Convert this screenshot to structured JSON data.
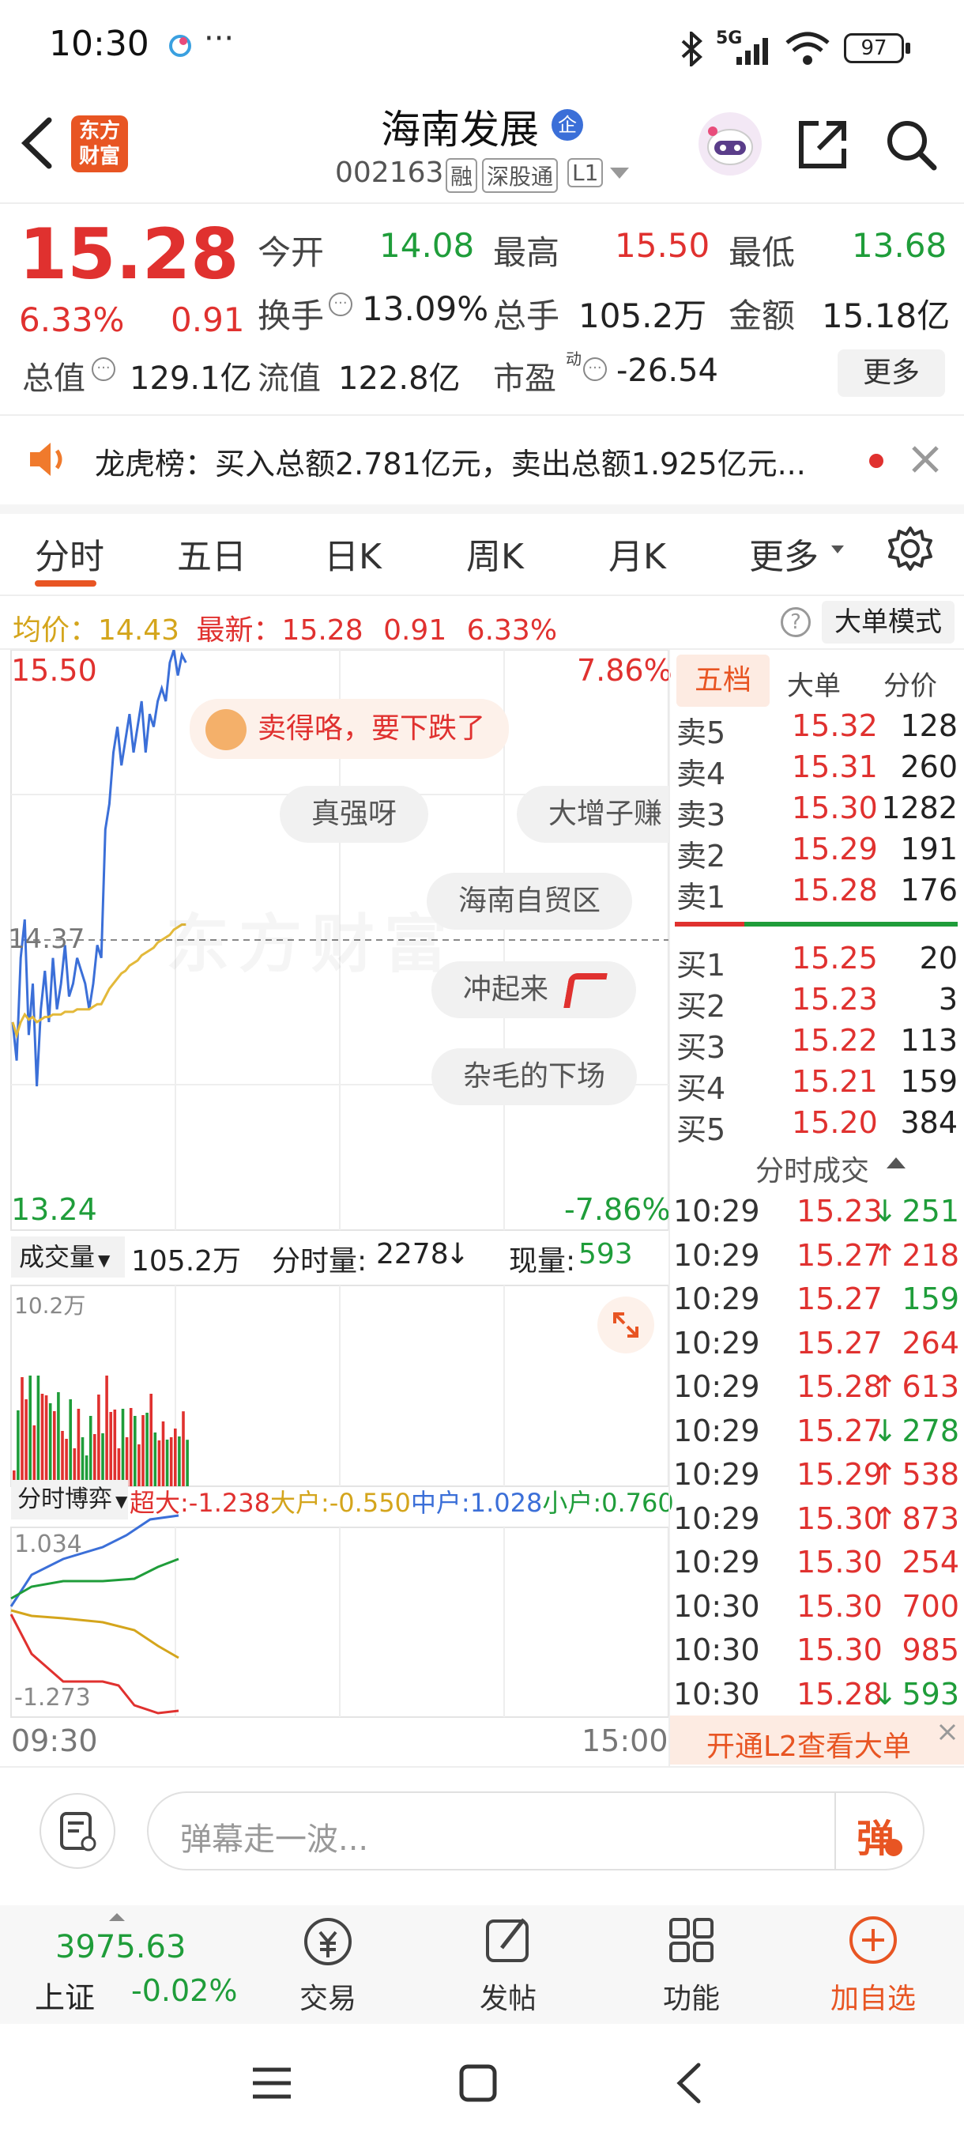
{
  "status": {
    "time": "10:30",
    "more": "···",
    "net": "5G",
    "battery": "97"
  },
  "header": {
    "title": "海南发展",
    "badge": "企",
    "code": "002163",
    "tag1": "融",
    "tag2": "深股通",
    "tag3": "L1",
    "logo_line1": "东方",
    "logo_line2": "财富"
  },
  "quote": {
    "price": "15.28",
    "change_pct": "6.33%",
    "change": "0.91",
    "open_label": "今开",
    "open": "14.08",
    "high_label": "最高",
    "high": "15.50",
    "low_label": "最低",
    "low": "13.68",
    "turnover_label": "换手",
    "turnover": "13.09%",
    "volume_label": "总手",
    "volume": "105.2万",
    "amount_label": "金额",
    "amount": "15.18亿",
    "mktcap_label": "总值",
    "mktcap": "129.1亿",
    "float_label": "流值",
    "float": "122.8亿",
    "pe_label": "市盈",
    "pe_sup": "动",
    "pe": "-26.54",
    "more": "更多"
  },
  "notice": {
    "text": "龙虎榜：买入总额2.781亿元，卖出总额1.925亿元..."
  },
  "tabs": [
    "分时",
    "五日",
    "日K",
    "周K",
    "月K",
    "更多"
  ],
  "info_bar": {
    "avg_label": "均价：",
    "avg": "14.43",
    "latest_label": "最新：",
    "latest": "15.28",
    "change": "0.91",
    "pct": "6.33%",
    "mode": "大单模式"
  },
  "chart": {
    "high": "15.50",
    "low": "13.24",
    "high_pct": "7.86%",
    "low_pct": "-7.86%",
    "mid": "14.37",
    "watermark": "东方财富",
    "vol_label": "成交量",
    "vol_total": "105.2万",
    "vol_fen_label": "分时量:",
    "vol_fen": "2278",
    "vol_now_label": "现量:",
    "vol_now": "593",
    "vol_max": "10.2万",
    "flow_label": "分时博弈",
    "super_label": "超大:",
    "super": "-1.238",
    "big_label": "大户:",
    "big": "-0.550",
    "mid_label": "中户:",
    "mid_val": "1.028",
    "small_label": "小户:",
    "small": "0.760",
    "flow_max": "1.034",
    "flow_min": "-1.273",
    "time_start": "09:30",
    "time_end": "15:00"
  },
  "chart_data": {
    "type": "line",
    "series": [
      {
        "name": "price",
        "values": [
          14.05,
          13.9,
          14.3,
          14.45,
          14.0,
          14.2,
          13.8,
          14.1,
          14.25,
          14.05,
          14.3,
          14.1,
          14.2,
          14.35,
          14.15,
          14.2,
          14.3,
          14.25,
          14.2,
          14.1,
          14.2,
          14.35,
          14.3,
          14.8,
          14.9,
          15.1,
          15.2,
          15.05,
          15.15,
          15.25,
          15.1,
          15.2,
          15.3,
          15.1,
          15.25,
          15.2,
          15.3,
          15.35,
          15.3,
          15.45,
          15.5,
          15.4,
          15.48,
          15.45
        ]
      },
      {
        "name": "均价",
        "values": [
          14.05,
          14.0,
          14.05,
          14.08,
          14.06,
          14.07,
          14.05,
          14.06,
          14.07,
          14.07,
          14.08,
          14.08,
          14.08,
          14.09,
          14.09,
          14.09,
          14.1,
          14.1,
          14.1,
          14.1,
          14.11,
          14.12,
          14.12,
          14.15,
          14.18,
          14.2,
          14.22,
          14.24,
          14.25,
          14.27,
          14.28,
          14.29,
          14.31,
          14.32,
          14.33,
          14.34,
          14.36,
          14.37,
          14.38,
          14.39,
          14.41,
          14.42,
          14.43,
          14.43
        ]
      }
    ],
    "ylim": [
      13.24,
      15.5
    ]
  },
  "order_book": {
    "tabs": [
      "五档",
      "大单",
      "分价"
    ],
    "asks": [
      {
        "label": "卖5",
        "price": "15.32",
        "vol": "128"
      },
      {
        "label": "卖4",
        "price": "15.31",
        "vol": "260"
      },
      {
        "label": "卖3",
        "price": "15.30",
        "vol": "1282"
      },
      {
        "label": "卖2",
        "price": "15.29",
        "vol": "191"
      },
      {
        "label": "卖1",
        "price": "15.28",
        "vol": "176"
      }
    ],
    "bids": [
      {
        "label": "买1",
        "price": "15.25",
        "vol": "20"
      },
      {
        "label": "买2",
        "price": "15.23",
        "vol": "3"
      },
      {
        "label": "买3",
        "price": "15.22",
        "vol": "113"
      },
      {
        "label": "买4",
        "price": "15.21",
        "vol": "159"
      },
      {
        "label": "买5",
        "price": "15.20",
        "vol": "384"
      }
    ],
    "ticks_title": "分时成交",
    "ticks": [
      {
        "time": "10:29",
        "price": "15.23",
        "dir": "↓",
        "vol": "251",
        "pc": "red",
        "vc": "green"
      },
      {
        "time": "10:29",
        "price": "15.27",
        "dir": "↑",
        "vol": "218",
        "pc": "red",
        "vc": "red"
      },
      {
        "time": "10:29",
        "price": "15.27",
        "dir": "",
        "vol": "159",
        "pc": "red",
        "vc": "green"
      },
      {
        "time": "10:29",
        "price": "15.27",
        "dir": "",
        "vol": "264",
        "pc": "red",
        "vc": "red"
      },
      {
        "time": "10:29",
        "price": "15.28",
        "dir": "↑",
        "vol": "613",
        "pc": "red",
        "vc": "red"
      },
      {
        "time": "10:29",
        "price": "15.27",
        "dir": "↓",
        "vol": "278",
        "pc": "red",
        "vc": "green"
      },
      {
        "time": "10:29",
        "price": "15.29",
        "dir": "↑",
        "vol": "538",
        "pc": "red",
        "vc": "red"
      },
      {
        "time": "10:29",
        "price": "15.30",
        "dir": "↑",
        "vol": "873",
        "pc": "red",
        "vc": "red"
      },
      {
        "time": "10:29",
        "price": "15.30",
        "dir": "",
        "vol": "254",
        "pc": "red",
        "vc": "red"
      },
      {
        "time": "10:30",
        "price": "15.30",
        "dir": "",
        "vol": "700",
        "pc": "red",
        "vc": "red"
      },
      {
        "time": "10:30",
        "price": "15.30",
        "dir": "",
        "vol": "985",
        "pc": "red",
        "vc": "red"
      },
      {
        "time": "10:30",
        "price": "15.28",
        "dir": "↓",
        "vol": "593",
        "pc": "red",
        "vc": "green"
      }
    ],
    "l2": "开通L2查看大单"
  },
  "danmaku": [
    "卖得咯，要下跌了",
    "真强呀",
    "大增子赚",
    "海南自贸区",
    "冲起来",
    "杂毛的下场"
  ],
  "comment": {
    "placeholder": "弹幕走一波...",
    "btn": "弹"
  },
  "nav": {
    "index_value": "3975.63",
    "index_name": "上证",
    "index_pct": "-0.02%",
    "trade": "交易",
    "post": "发帖",
    "func": "功能",
    "add": "加自选"
  }
}
